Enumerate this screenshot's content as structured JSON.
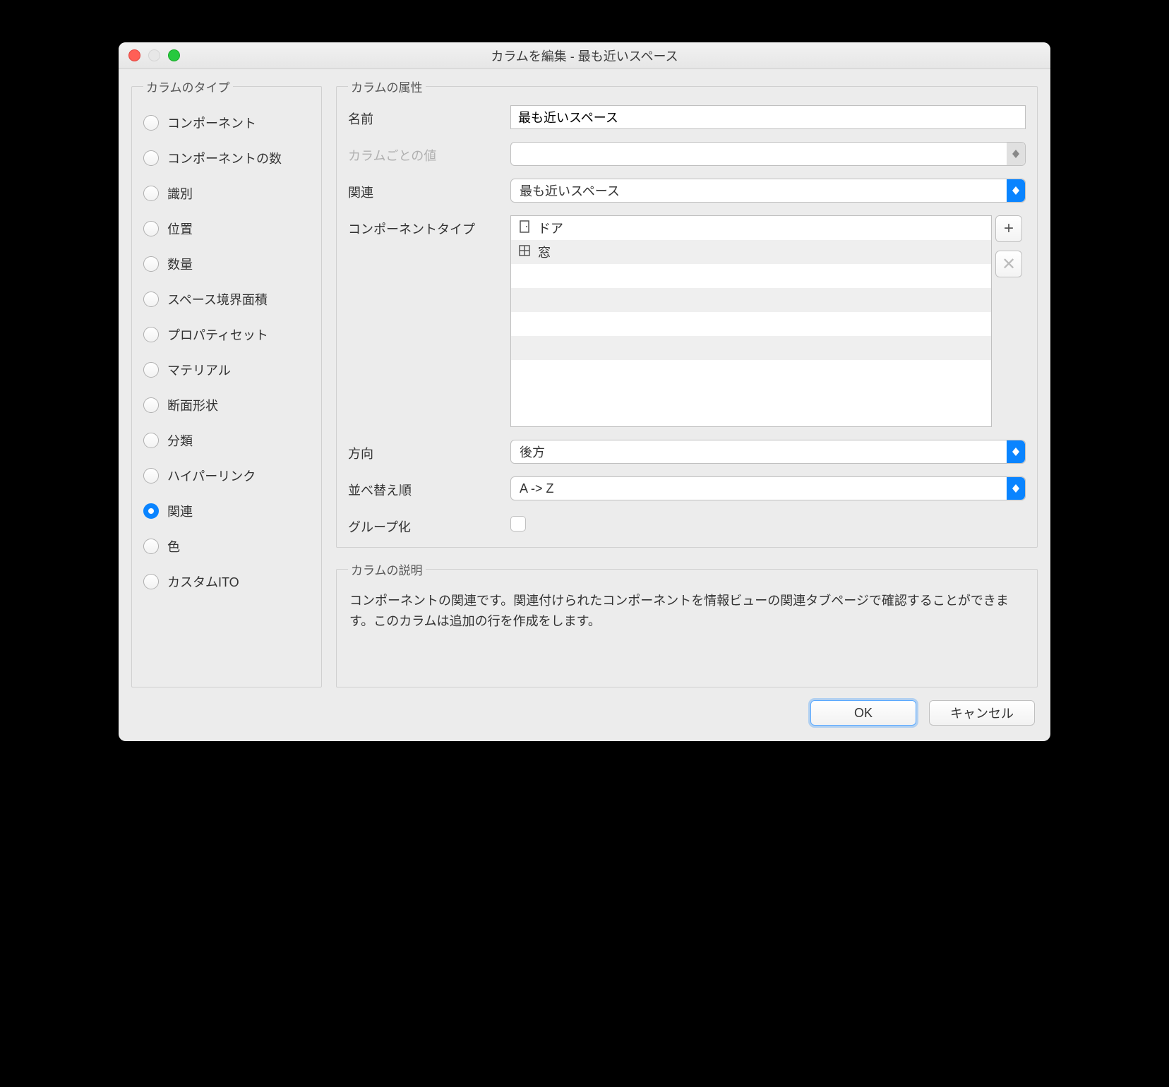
{
  "window": {
    "title": "カラムを編集 - 最も近いスペース"
  },
  "left": {
    "legend": "カラムのタイプ",
    "items": [
      {
        "label": "コンポーネント",
        "selected": false
      },
      {
        "label": "コンポーネントの数",
        "selected": false
      },
      {
        "label": "識別",
        "selected": false
      },
      {
        "label": "位置",
        "selected": false
      },
      {
        "label": "数量",
        "selected": false
      },
      {
        "label": "スペース境界面積",
        "selected": false
      },
      {
        "label": "プロパティセット",
        "selected": false
      },
      {
        "label": "マテリアル",
        "selected": false
      },
      {
        "label": "断面形状",
        "selected": false
      },
      {
        "label": "分類",
        "selected": false
      },
      {
        "label": "ハイパーリンク",
        "selected": false
      },
      {
        "label": "関連",
        "selected": true
      },
      {
        "label": "色",
        "selected": false
      },
      {
        "label": "カスタムITO",
        "selected": false
      }
    ]
  },
  "attrs": {
    "legend": "カラムの属性",
    "name_label": "名前",
    "name_value": "最も近いスペース",
    "percol_label": "カラムごとの値",
    "percol_value": "",
    "rel_label": "関連",
    "rel_value": "最も近いスペース",
    "comptype_label": "コンポーネントタイプ",
    "comptype_items": [
      {
        "icon": "door",
        "label": "ドア"
      },
      {
        "icon": "window",
        "label": "窓"
      }
    ],
    "dir_label": "方向",
    "dir_value": "後方",
    "sort_label": "並べ替え順",
    "sort_value": "A -> Z",
    "group_label": "グループ化",
    "group_checked": false
  },
  "desc": {
    "legend": "カラムの説明",
    "text": "コンポーネントの関連です。関連付けられたコンポーネントを情報ビューの関連タブページで確認することができます。このカラムは追加の行を作成をします。"
  },
  "footer": {
    "ok": "OK",
    "cancel": "キャンセル"
  }
}
